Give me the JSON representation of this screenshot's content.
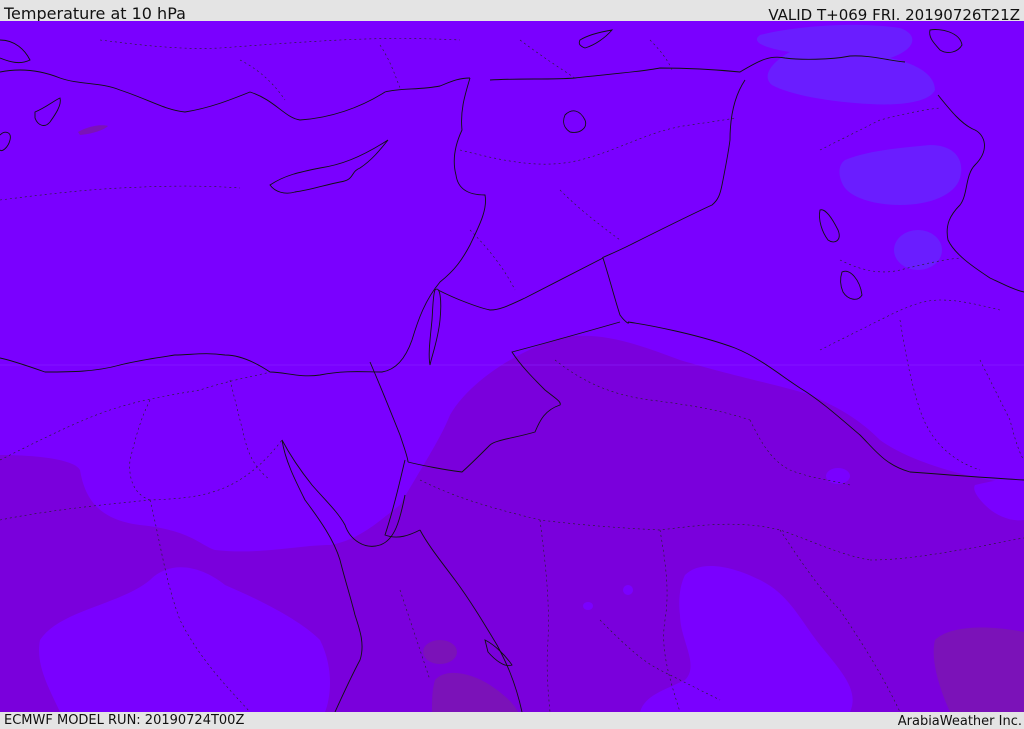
{
  "header": {
    "title": "Temperature at 10 hPa",
    "valid": "VALID T+069 FRI. 20190726T21Z"
  },
  "footer": {
    "model_run": "ECMWF MODEL RUN: 20190724T00Z",
    "credit": "ArabiaWeather Inc."
  },
  "map": {
    "colors": {
      "base_fill": "#7a00ff",
      "warmer_fill": "#7a00dc",
      "warmest_fill": "#7b12b8",
      "cooler_fill": "#6a1dff",
      "border_line": "#111111"
    }
  }
}
